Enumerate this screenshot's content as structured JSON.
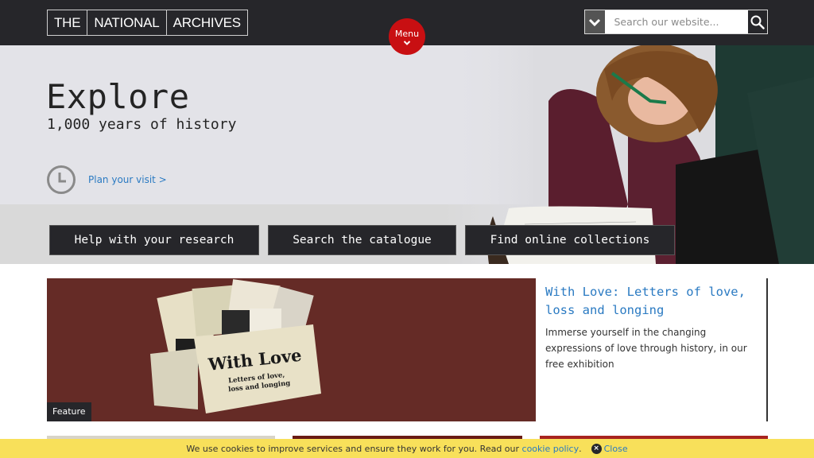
{
  "header": {
    "logo_parts": [
      "THE",
      "NATIONAL",
      "ARCHIVES"
    ],
    "menu_label": "Menu",
    "search": {
      "placeholder": "Search our website...",
      "value": ""
    }
  },
  "hero": {
    "title": "Explore",
    "subtitle": "1,000 years of history",
    "visit_link": "Plan your visit >",
    "buttons": [
      {
        "label": "Help with your research"
      },
      {
        "label": "Search the catalogue"
      },
      {
        "label": "Find online collections"
      }
    ]
  },
  "feature": {
    "badge": "Feature",
    "image_title": "With Love",
    "image_subtitle": "Letters of love, loss and longing",
    "title": "With Love: Letters of love, loss and longing",
    "description": "Immerse yourself in the changing expressions of love through history, in our free exhibition"
  },
  "cookie_banner": {
    "text": "We use cookies to improve services and ensure they work for you. Read our ",
    "link_label": "cookie policy",
    "after_link": ".",
    "close_label": "Close"
  },
  "colors": {
    "header_bg": "#26262a",
    "menu_red": "#c80f12",
    "link_blue": "#2a7ac2",
    "cookie_yellow": "#f8e05a"
  }
}
